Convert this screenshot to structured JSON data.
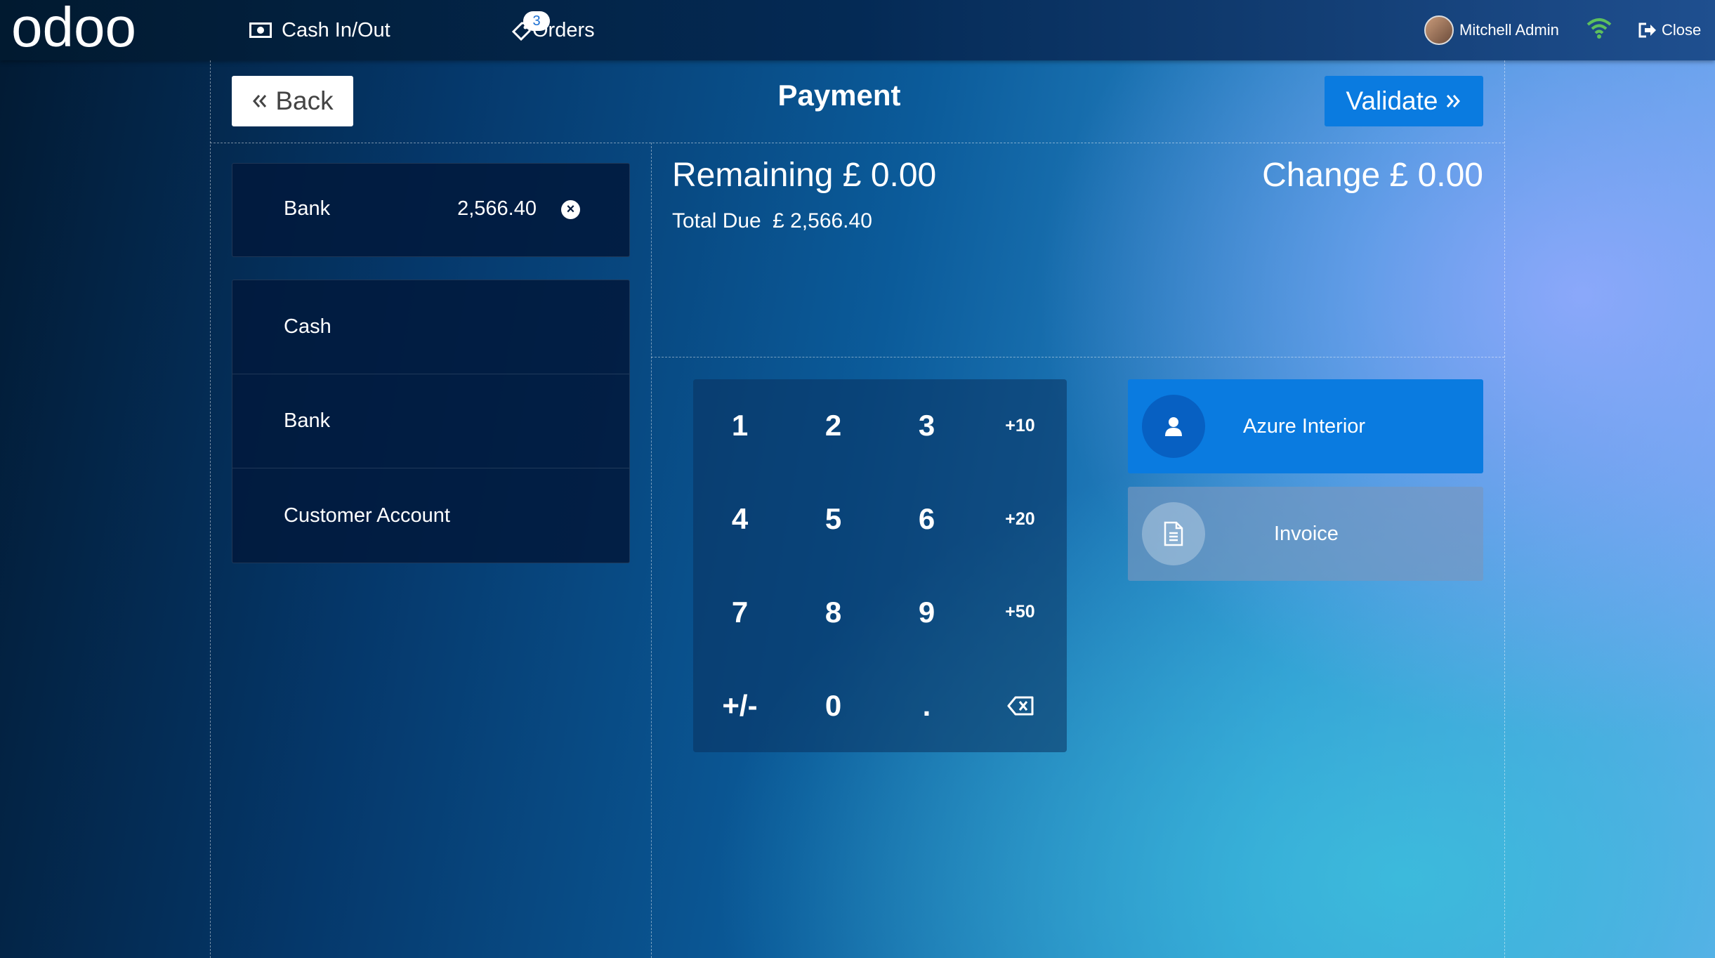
{
  "topbar": {
    "logo_text": "odoo",
    "cash_label": "Cash In/Out",
    "orders_label": "Orders",
    "orders_count": "3",
    "user_name": "Mitchell Admin",
    "close_label": "Close"
  },
  "header": {
    "back_label": "Back",
    "title": "Payment",
    "validate_label": "Validate"
  },
  "paymentline": {
    "method": "Bank",
    "amount": "2,566.40"
  },
  "methods": [
    "Cash",
    "Bank",
    "Customer Account"
  ],
  "summary": {
    "remaining_label": "Remaining",
    "remaining_value": "£ 0.00",
    "change_label": "Change",
    "change_value": "£ 0.00",
    "total_due_label": "Total Due",
    "total_due_value": "£ 2,566.40"
  },
  "numpad": [
    "1",
    "2",
    "3",
    "+10",
    "4",
    "5",
    "6",
    "+20",
    "7",
    "8",
    "9",
    "+50",
    "+/-",
    "0",
    "."
  ],
  "customer": {
    "name": "Azure Interior",
    "invoice_label": "Invoice"
  },
  "icons": {
    "cash": "money-icon",
    "orders": "tag-icon",
    "wifi": "wifi-icon",
    "close": "sign-out-icon",
    "back": "double-chevron-left-icon",
    "validate": "double-chevron-right-icon",
    "delete_line": "close-circle-icon",
    "customer": "user-icon",
    "invoice": "file-icon",
    "backspace": "backspace-icon"
  },
  "colors": {
    "accent": "#0a7be0",
    "wifi_ok": "#5dc05d"
  }
}
